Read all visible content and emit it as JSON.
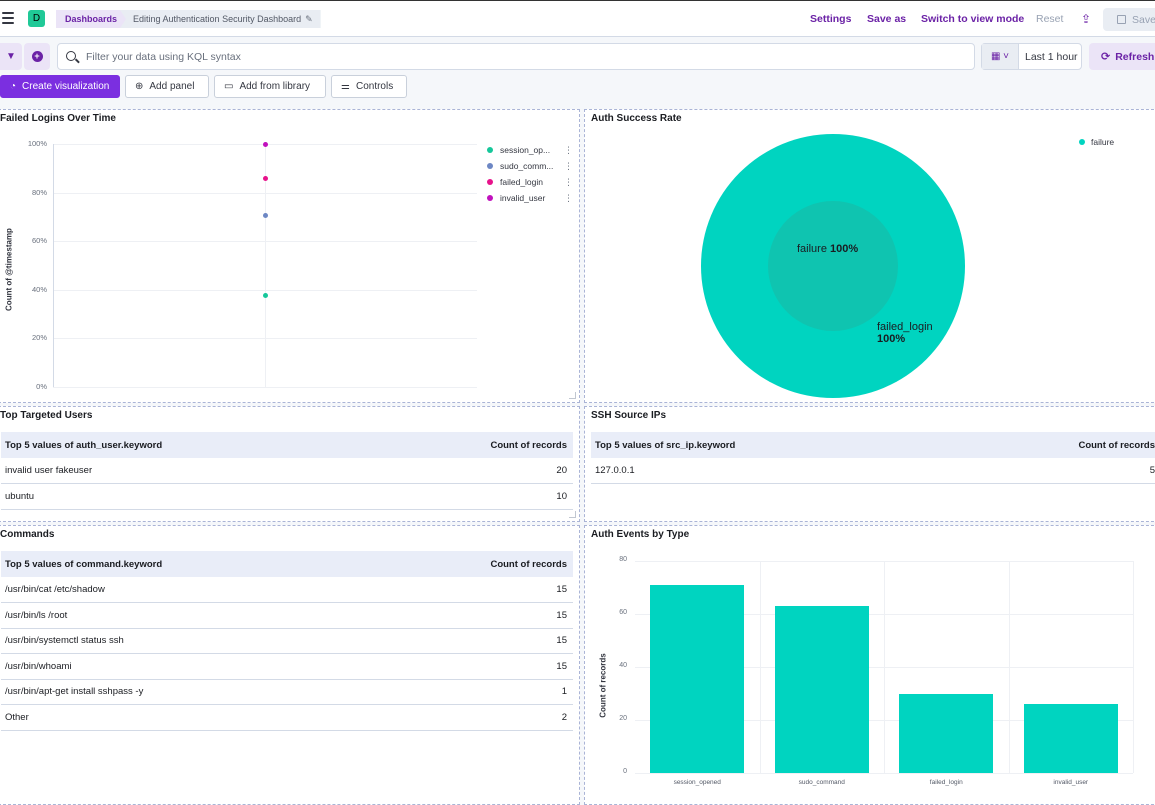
{
  "header": {
    "space_initial": "D",
    "breadcrumb_root": "Dashboards",
    "breadcrumb_current": "Editing Authentication Security Dashboard",
    "settings_label": "Settings",
    "save_as_label": "Save as",
    "view_mode_label": "Switch to view mode",
    "reset_label": "Reset",
    "save_label": "Save"
  },
  "query": {
    "placeholder": "Filter your data using KQL syntax",
    "time_range": "Last 1 hour",
    "refresh_label": "Refresh"
  },
  "toolbar": {
    "create_label": "Create visualization",
    "add_panel_label": "Add panel",
    "add_library_label": "Add from library",
    "controls_label": "Controls"
  },
  "colors": {
    "accent": "#6b22a6",
    "teal": "#00d4c0",
    "session_opened": "#16c79a",
    "sudo_command": "#6d87c4",
    "failed_login": "#e7128b",
    "invalid_user": "#c111bd"
  },
  "panels": {
    "failed_logins": {
      "title": "Failed Logins Over Time",
      "ylabel": "Count of @timestamp",
      "legend": [
        {
          "label": "session_op...",
          "color": "#16c79a"
        },
        {
          "label": "sudo_comm...",
          "color": "#6d87c4"
        },
        {
          "label": "failed_login",
          "color": "#e7128b"
        },
        {
          "label": "invalid_user",
          "color": "#c111bd"
        }
      ]
    },
    "auth_success": {
      "title": "Auth Success Rate",
      "legend_label": "failure",
      "inner_label": "failure",
      "inner_pct": "100%",
      "outer_label": "failed_login",
      "outer_pct": "100%"
    },
    "top_users": {
      "title": "Top Targeted Users",
      "col1": "Top 5 values of auth_user.keyword",
      "col2": "Count of records",
      "rows": [
        {
          "name": "invalid user fakeuser",
          "count": "20"
        },
        {
          "name": "ubuntu",
          "count": "10"
        }
      ]
    },
    "ssh_ips": {
      "title": "SSH Source IPs",
      "col1": "Top 5 values of src_ip.keyword",
      "col2": "Count of records",
      "rows": [
        {
          "name": "127.0.0.1",
          "count": "5"
        }
      ]
    },
    "commands": {
      "title": "Commands",
      "col1": "Top 5 values of command.keyword",
      "col2": "Count of records",
      "rows": [
        {
          "name": "/usr/bin/cat /etc/shadow",
          "count": "15"
        },
        {
          "name": "/usr/bin/ls /root",
          "count": "15"
        },
        {
          "name": "/usr/bin/systemctl status ssh",
          "count": "15"
        },
        {
          "name": "/usr/bin/whoami",
          "count": "15"
        },
        {
          "name": "/usr/bin/apt-get install sshpass -y",
          "count": "1"
        },
        {
          "name": "Other",
          "count": "2"
        }
      ]
    },
    "auth_events": {
      "title": "Auth Events by Type",
      "ylabel": "Count of records"
    }
  },
  "chart_data": [
    {
      "type": "scatter",
      "title": "Failed Logins Over Time",
      "ylabel": "Count of @timestamp",
      "yticks": [
        "100%",
        "80%",
        "60%",
        "40%",
        "20%",
        "0%"
      ],
      "ylim": [
        0,
        100
      ],
      "series": [
        {
          "name": "session_opened",
          "values": [
            37.5
          ]
        },
        {
          "name": "sudo_command",
          "values": [
            70.5
          ]
        },
        {
          "name": "failed_login",
          "values": [
            86
          ]
        },
        {
          "name": "invalid_user",
          "values": [
            100
          ]
        }
      ]
    },
    {
      "type": "pie",
      "title": "Auth Success Rate",
      "rings": [
        {
          "label": "failure",
          "value": 100
        },
        {
          "label": "failed_login",
          "value": 100
        }
      ]
    },
    {
      "type": "bar",
      "title": "Auth Events by Type",
      "ylabel": "Count of records",
      "categories": [
        "session_opened",
        "sudo_command",
        "failed_login",
        "invalid_user"
      ],
      "values": [
        71,
        63,
        30,
        26
      ],
      "yticks": [
        "80",
        "60",
        "40",
        "20",
        "0"
      ],
      "ylim": [
        0,
        80
      ]
    }
  ]
}
